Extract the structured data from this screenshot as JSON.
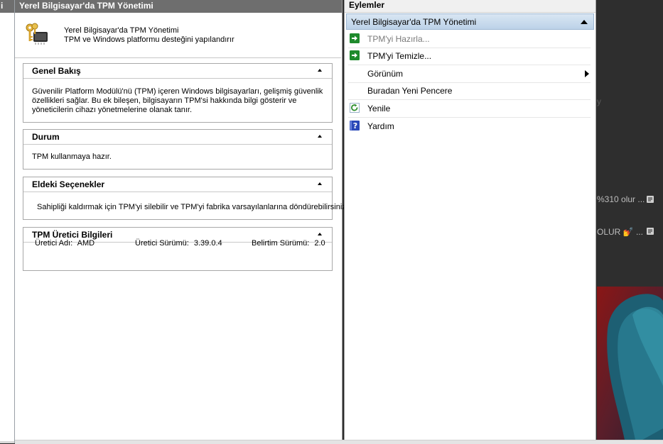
{
  "edge": {
    "title": "i"
  },
  "main": {
    "window_title": "Yerel Bilgisayar'da TPM Yönetimi",
    "header_line1": "Yerel Bilgisayar'da TPM Yönetimi",
    "header_line2": "TPM ve Windows platformu desteğini yapılandırır",
    "sections": [
      {
        "title": "Genel Bakış",
        "lines": [
          "Güvenilir Platform Modülü'nü (TPM) içeren Windows bilgisayarları, gelişmiş güvenlik",
          "özellikleri sağlar. Bu ek bileşen, bilgisayarın TPM'si hakkında bilgi gösterir ve",
          "yöneticilerin cihazı yönetmelerine olanak tanır."
        ]
      },
      {
        "title": "Durum",
        "text": "TPM kullanmaya hazır."
      },
      {
        "title": "Eldeki Seçenekler",
        "text": "Sahipliği kaldırmak için TPM'yi silebilir ve TPM'yi fabrika varsayılanlarına döndürebilirsiniz."
      },
      {
        "title": "TPM Üretici Bilgileri",
        "manufacturer_label": "Üretici Adı:",
        "manufacturer_value": "AMD",
        "version_label": "Üretici Sürümü:",
        "version_value": "3.39.0.4",
        "spec_label": "Belirtim Sürümü:",
        "spec_value": "2.0"
      }
    ]
  },
  "actions": {
    "title": "Eylemler",
    "group_label": "Yerel Bilgisayar'da TPM Yönetimi",
    "items": [
      {
        "label": "TPM'yi Hazırla...",
        "icon": "green-arrow-icon",
        "disabled": true
      },
      {
        "label": "TPM'yi Temizle...",
        "icon": "green-arrow-icon",
        "disabled": false
      },
      {
        "label": "Görünüm",
        "icon": "",
        "submenu": true
      },
      {
        "label": "Buradan Yeni Pencere",
        "icon": ""
      },
      {
        "label": "Yenile",
        "icon": "refresh-icon"
      },
      {
        "label": "Yardım",
        "icon": "help-icon"
      }
    ]
  },
  "background": {
    "ghost1": "y",
    "ghost2": "%310 olur ...",
    "ghost3": "OLUR 💅 ..."
  },
  "colors": {
    "title_bar": "#6e6e6e",
    "group_header": "#c6d8ec",
    "action_green": "#1e8a2c",
    "help_blue": "#2a48b8"
  }
}
